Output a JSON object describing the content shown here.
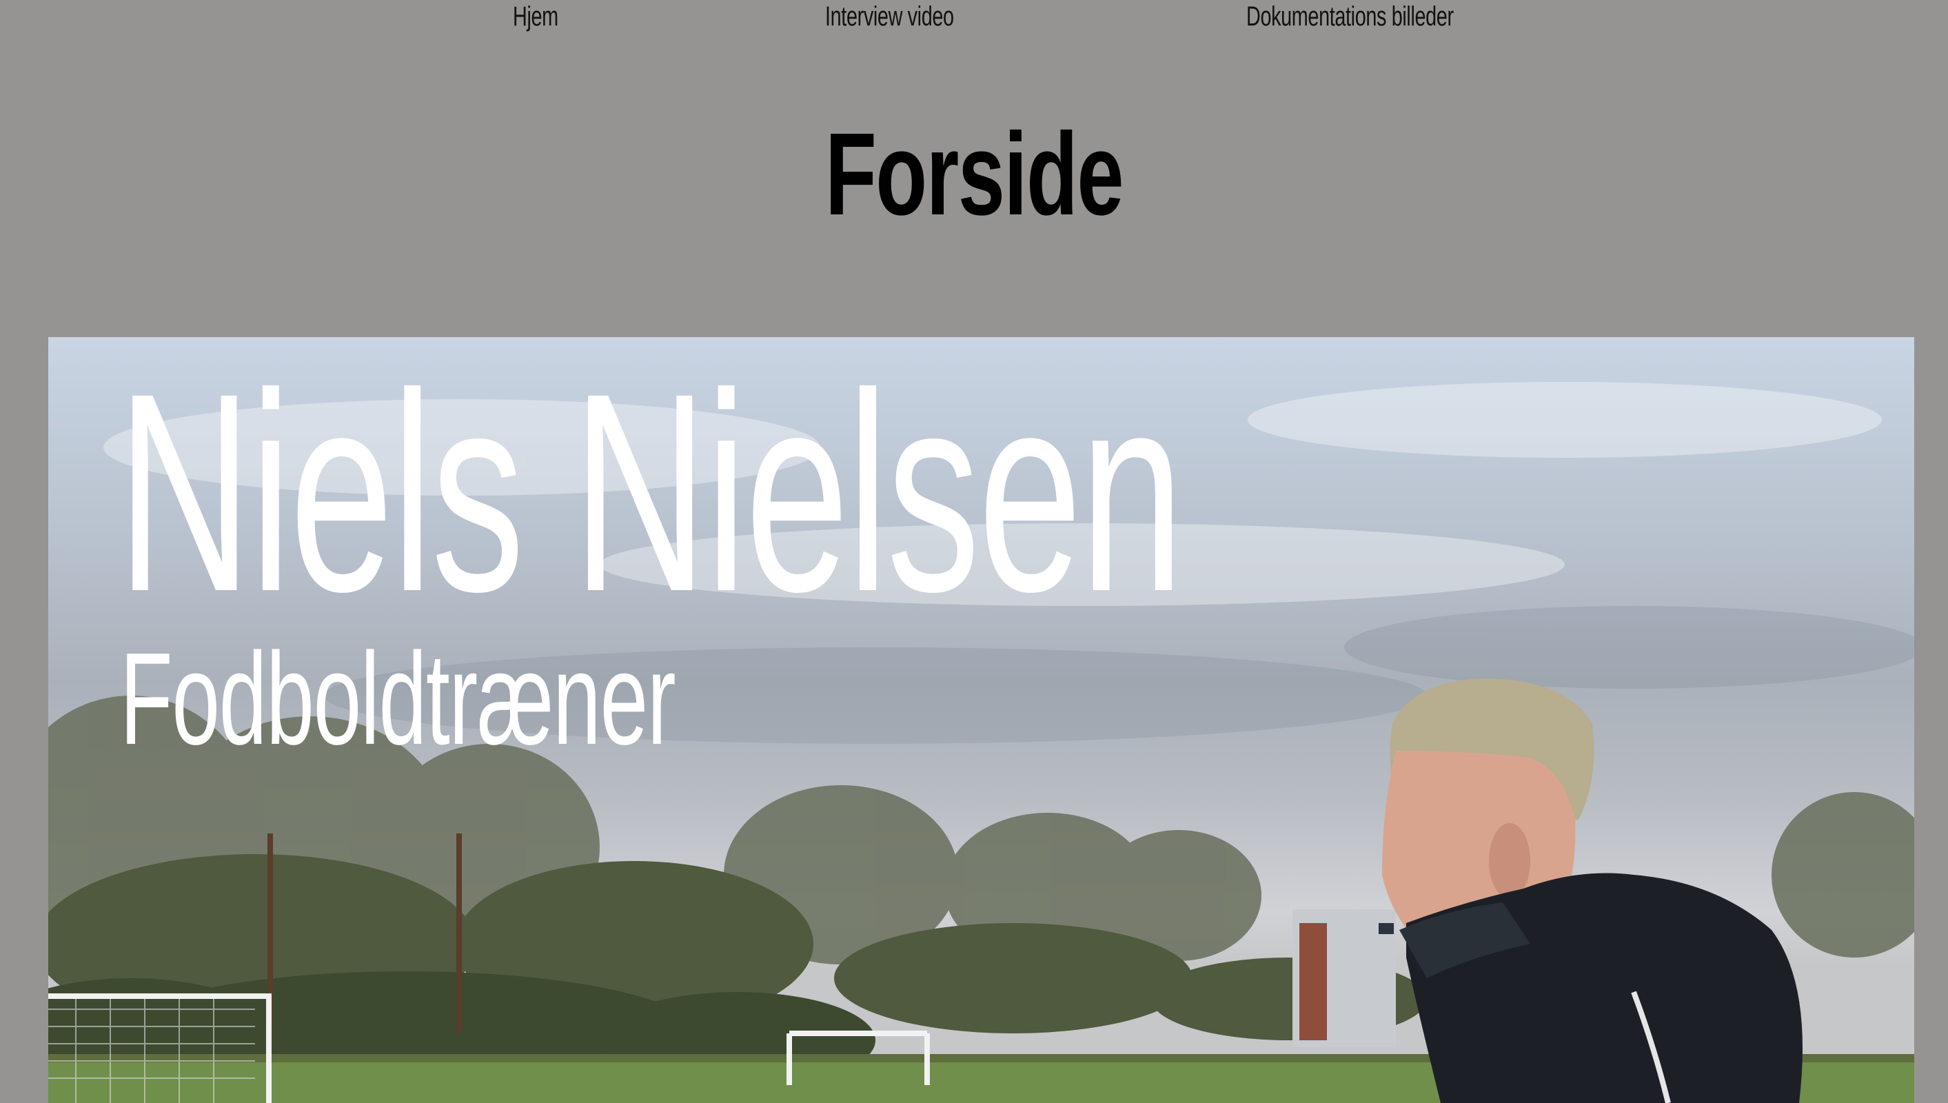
{
  "nav": {
    "items": [
      {
        "label": "Hjem"
      },
      {
        "label": "Interview video"
      },
      {
        "label": "Dokumentations billeder"
      }
    ]
  },
  "page": {
    "title": "Forside"
  },
  "hero": {
    "name": "Niels Nielsen",
    "subtitle": "Fodboldtræner"
  },
  "colors": {
    "background": "#959492",
    "text_dark": "#111111",
    "hero_text": "#ffffff"
  }
}
